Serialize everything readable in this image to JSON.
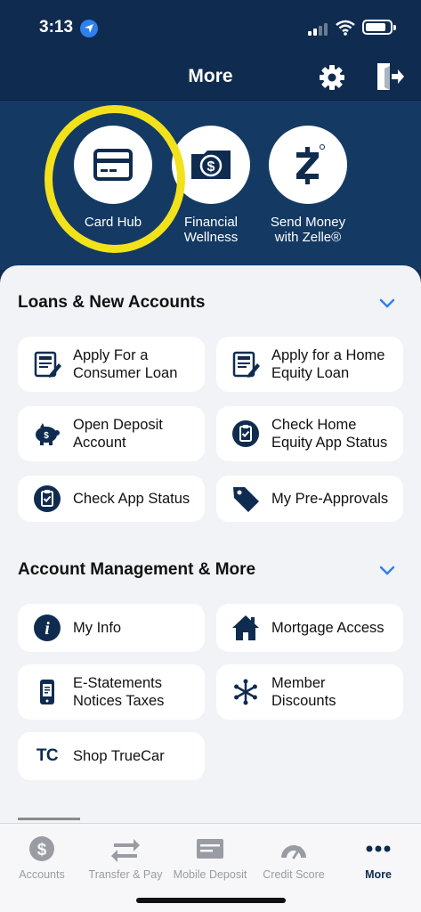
{
  "status_bar": {
    "time": "3:13"
  },
  "header": {
    "title": "More"
  },
  "quick_actions": [
    {
      "label_line1": "Card Hub",
      "label_line2": "",
      "icon": "credit-card-icon"
    },
    {
      "label_line1": "Financial",
      "label_line2": "Wellness",
      "icon": "dollar-folder-icon"
    },
    {
      "label_line1": "Send Money",
      "label_line2": "with Zelle®",
      "icon": "zelle-icon"
    }
  ],
  "sections": [
    {
      "title": "Loans & New Accounts",
      "tiles": [
        {
          "line1": "Apply For a",
          "line2": "Consumer Loan",
          "icon": "loan-document-icon"
        },
        {
          "line1": "Apply for a Home",
          "line2": "Equity Loan",
          "icon": "loan-document-icon"
        },
        {
          "line1": "Open Deposit",
          "line2": "Account",
          "icon": "piggy-bank-icon"
        },
        {
          "line1": "Check Home",
          "line2": "Equity App Status",
          "icon": "clipboard-check-icon"
        },
        {
          "line1": "Check App Status",
          "line2": "",
          "icon": "clipboard-check-icon"
        },
        {
          "line1": "My Pre-Approvals",
          "line2": "",
          "icon": "tag-icon"
        }
      ]
    },
    {
      "title": "Account Management & More",
      "tiles": [
        {
          "line1": "My Info",
          "line2": "",
          "icon": "info-icon"
        },
        {
          "line1": "Mortgage Access",
          "line2": "",
          "icon": "house-icon"
        },
        {
          "line1": "E-Statements",
          "line2": "Notices Taxes",
          "icon": "phone-document-icon"
        },
        {
          "line1": "Member",
          "line2": "Discounts",
          "icon": "snowflake-icon"
        },
        {
          "line1": "Shop TrueCar",
          "line2": "",
          "icon": "truecar-icon",
          "icon_text": "TC"
        }
      ]
    }
  ],
  "tab_bar": [
    {
      "label": "Accounts",
      "icon": "dollar-coin-icon",
      "active": false
    },
    {
      "label": "Transfer & Pay",
      "icon": "transfer-arrows-icon",
      "active": false
    },
    {
      "label": "Mobile Deposit",
      "icon": "check-deposit-icon",
      "active": false
    },
    {
      "label": "Credit Score",
      "icon": "gauge-icon",
      "active": false
    },
    {
      "label": "More",
      "icon": "more-dots-icon",
      "active": true
    }
  ],
  "colors": {
    "navy": "#0f2c50",
    "highlight": "#f2e21c",
    "accent_blue": "#2f80ed"
  }
}
